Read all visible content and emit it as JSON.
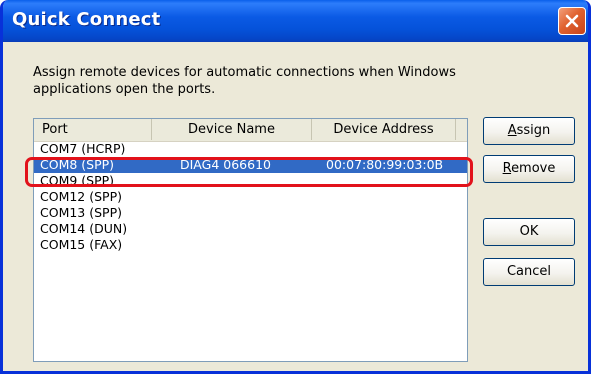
{
  "window": {
    "title": "Quick Connect"
  },
  "description": "Assign remote devices for automatic connections when Windows applications open the ports.",
  "table": {
    "columns": [
      "Port",
      "Device Name",
      "Device Address"
    ],
    "rows": [
      {
        "port": "COM7 (HCRP)",
        "name": "",
        "address": "",
        "selected": false
      },
      {
        "port": "COM8 (SPP)",
        "name": "DIAG4 066610",
        "address": "00:07:80:99:03:0B",
        "selected": true
      },
      {
        "port": "COM9 (SPP)",
        "name": "",
        "address": "",
        "selected": false
      },
      {
        "port": "COM12 (SPP)",
        "name": "",
        "address": "",
        "selected": false
      },
      {
        "port": "COM13 (SPP)",
        "name": "",
        "address": "",
        "selected": false
      },
      {
        "port": "COM14 (DUN)",
        "name": "",
        "address": "",
        "selected": false
      },
      {
        "port": "COM15 (FAX)",
        "name": "",
        "address": "",
        "selected": false
      }
    ]
  },
  "buttons": {
    "assign": {
      "accel": "A",
      "rest": "ssign"
    },
    "remove": {
      "accel": "R",
      "rest": "emove"
    },
    "ok": "OK",
    "cancel": "Cancel"
  },
  "colors": {
    "selection": "#316ac5",
    "highlight_ring": "#e2121b",
    "titlebar": "#0552d9"
  },
  "icons": {
    "close": "close-x-icon"
  }
}
